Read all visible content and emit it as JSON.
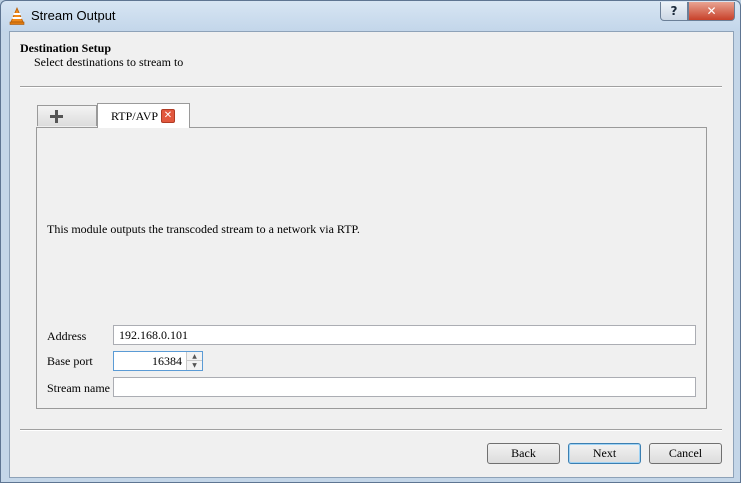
{
  "window": {
    "title": "Stream Output",
    "help_label": "?",
    "close_label": "✕"
  },
  "header": {
    "title": "Destination Setup",
    "subtitle": "Select destinations to stream to"
  },
  "tabs": {
    "add_icon": "plus-icon",
    "active_label": "RTP/AVP",
    "close_glyph": "✕"
  },
  "panel": {
    "description": "This module outputs the transcoded stream to a network via RTP.",
    "address_label": "Address",
    "address_value": "192.168.0.101",
    "base_port_label": "Base port",
    "base_port_value": "16384",
    "stream_name_label": "Stream name",
    "stream_name_value": ""
  },
  "buttons": {
    "back": "Back",
    "next": "Next",
    "cancel": "Cancel"
  },
  "colors": {
    "close_red": "#c8412a",
    "tab_close": "#e2583e",
    "focus_blue": "#5b9bd5"
  }
}
